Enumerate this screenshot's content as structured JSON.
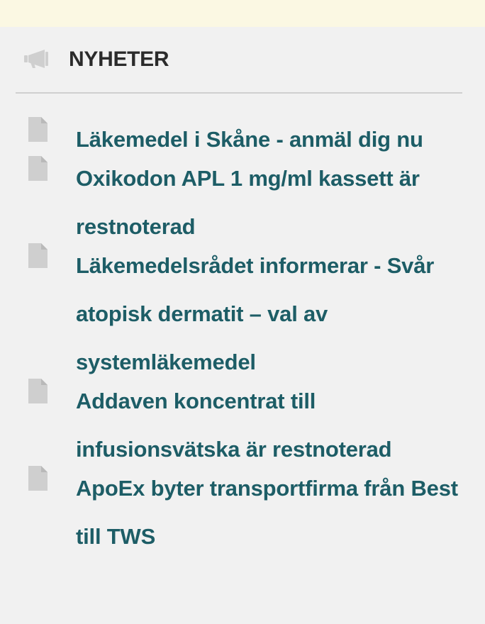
{
  "header": {
    "title": "NYHETER",
    "icon": "megaphone-icon"
  },
  "news": {
    "item_icon": "document-icon",
    "items": [
      {
        "label": "Läkemedel i Skåne - anmäl dig nu"
      },
      {
        "label": "Oxikodon APL 1 mg/ml kassett är restnoterad"
      },
      {
        "label": "Läkemedelsrådet informerar - Svår atopisk dermatit – val av systemläkemedel"
      },
      {
        "label": "Addaven koncentrat till infusionsvätska är restnoterad"
      },
      {
        "label": "ApoEx byter transportfirma från Best till TWS"
      }
    ]
  },
  "colors": {
    "banner": "#fbf8e3",
    "background": "#f1f1f1",
    "link": "#1d5d66",
    "heading": "#2b2b2b",
    "icon": "#cfcfcf"
  }
}
